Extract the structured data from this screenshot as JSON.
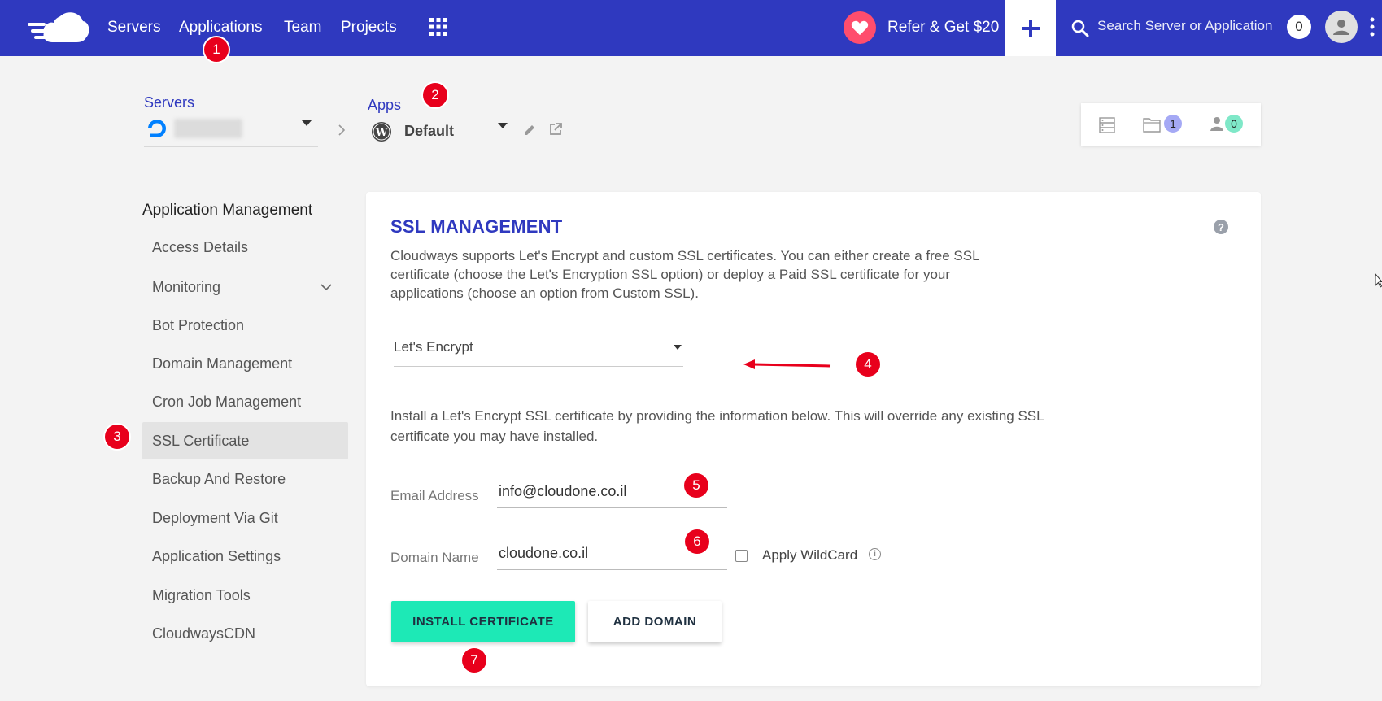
{
  "topnav": {
    "items": [
      "Servers",
      "Applications",
      "Team",
      "Projects"
    ],
    "refer_label": "Refer & Get $20",
    "search_placeholder": "Search Server or Application",
    "notification_count": "0",
    "icons": [
      "cloudways-logo-icon",
      "apps-grid-icon",
      "heart-icon",
      "plus-icon",
      "search-icon",
      "user-icon",
      "kebab-menu-icon"
    ]
  },
  "breadcrumb": {
    "servers_label": "Servers",
    "apps_label": "Apps",
    "app_name": "Default"
  },
  "stats": {
    "folder_count": "1",
    "users_count": "0"
  },
  "sidebar": {
    "title": "Application Management",
    "items": [
      "Access Details",
      "Monitoring",
      "Bot Protection",
      "Domain Management",
      "Cron Job Management",
      "SSL Certificate",
      "Backup And Restore",
      "Deployment Via Git",
      "Application Settings",
      "Migration Tools",
      "CloudwaysCDN"
    ],
    "active_item": "SSL Certificate"
  },
  "ssl": {
    "title": "SSL MANAGEMENT",
    "description_lines": [
      "Cloudways supports Let's Encrypt and custom SSL certificates. You can either create a free SSL",
      "certificate (choose the Let's Encryption SSL option) or deploy a Paid SSL certificate for your",
      "applications (choose an option from Custom SSL)."
    ],
    "ssl_type_selected": "Let's Encrypt",
    "install_info_lines": [
      "Install a Let's Encrypt SSL certificate by providing the information below. This will override any existing SSL",
      "certificate you may have installed."
    ],
    "email_label": "Email Address",
    "email_value": "info@cloudone.co.il",
    "domain_label": "Domain Name",
    "domain_value": "cloudone.co.il",
    "wildcard_label": "Apply WildCard",
    "install_button": "INSTALL CERTIFICATE",
    "add_domain_button": "ADD DOMAIN"
  },
  "annotations": [
    "1",
    "2",
    "3",
    "4",
    "5",
    "6",
    "7"
  ],
  "colors": {
    "brand": "#2f39bf",
    "primary_button": "#1de9b6",
    "annotation": "#e8001c",
    "background": "#f3f3f3"
  }
}
